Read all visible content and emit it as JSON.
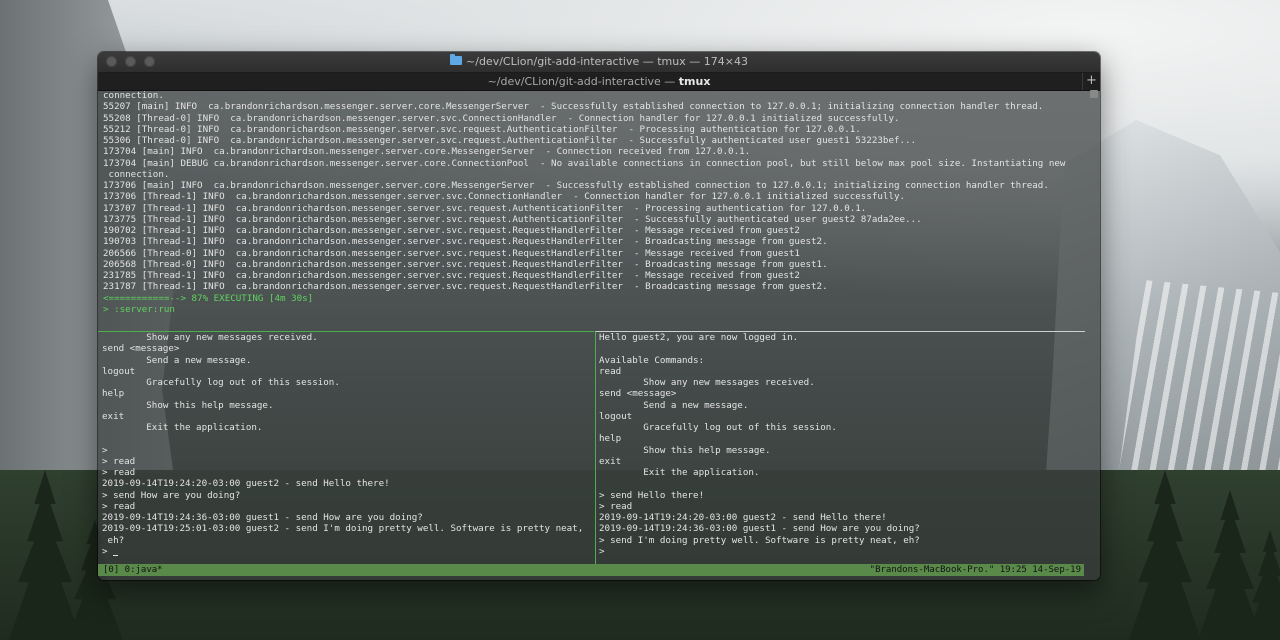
{
  "window": {
    "title": "~/dev/CLion/git-add-interactive — tmux — 174×43",
    "tab_path": "~/dev/CLion/git-add-interactive — ",
    "tab_app": "tmux",
    "add_tab": "+"
  },
  "log_lines": [
    "connection.",
    "55207 [main] INFO  ca.brandonrichardson.messenger.server.core.MessengerServer  - Successfully established connection to 127.0.0.1; initializing connection handler thread.",
    "55208 [Thread-0] INFO  ca.brandonrichardson.messenger.server.svc.ConnectionHandler  - Connection handler for 127.0.0.1 initialized successfully.",
    "55212 [Thread-0] INFO  ca.brandonrichardson.messenger.server.svc.request.AuthenticationFilter  - Processing authentication for 127.0.0.1.",
    "55306 [Thread-0] INFO  ca.brandonrichardson.messenger.server.svc.request.AuthenticationFilter  - Successfully authenticated user guest1 53223bef...",
    "173704 [main] INFO  ca.brandonrichardson.messenger.server.core.MessengerServer  - Connection received from 127.0.0.1.",
    "173704 [main] DEBUG ca.brandonrichardson.messenger.server.core.ConnectionPool  - No available connections in connection pool, but still below max pool size. Instantiating new",
    " connection.",
    "173706 [main] INFO  ca.brandonrichardson.messenger.server.core.MessengerServer  - Successfully established connection to 127.0.0.1; initializing connection handler thread.",
    "173706 [Thread-1] INFO  ca.brandonrichardson.messenger.server.svc.ConnectionHandler  - Connection handler for 127.0.0.1 initialized successfully.",
    "173707 [Thread-1] INFO  ca.brandonrichardson.messenger.server.svc.request.AuthenticationFilter  - Processing authentication for 127.0.0.1.",
    "173775 [Thread-1] INFO  ca.brandonrichardson.messenger.server.svc.request.AuthenticationFilter  - Successfully authenticated user guest2 87ada2ee...",
    "190702 [Thread-1] INFO  ca.brandonrichardson.messenger.server.svc.request.RequestHandlerFilter  - Message received from guest2",
    "190703 [Thread-1] INFO  ca.brandonrichardson.messenger.server.svc.request.RequestHandlerFilter  - Broadcasting message from guest2.",
    "206566 [Thread-0] INFO  ca.brandonrichardson.messenger.server.svc.request.RequestHandlerFilter  - Message received from guest1",
    "206568 [Thread-0] INFO  ca.brandonrichardson.messenger.server.svc.request.RequestHandlerFilter  - Broadcasting message from guest1.",
    "231785 [Thread-1] INFO  ca.brandonrichardson.messenger.server.svc.request.RequestHandlerFilter  - Message received from guest2",
    "231787 [Thread-1] INFO  ca.brandonrichardson.messenger.server.svc.request.RequestHandlerFilter  - Broadcasting message from guest2."
  ],
  "progress_line": "<===========--> 87% EXECUTING [4m 30s]",
  "gradle_task": "> :server:run",
  "left_pane": [
    "        Show any new messages received.",
    "send <message>",
    "        Send a new message.",
    "logout",
    "        Gracefully log out of this session.",
    "help",
    "        Show this help message.",
    "exit",
    "        Exit the application.",
    "",
    ">",
    "> read",
    "> read",
    "2019-09-14T19:24:20-03:00 guest2 - send Hello there!",
    "> send How are you doing?",
    "> read",
    "2019-09-14T19:24:36-03:00 guest1 - send How are you doing?",
    "2019-09-14T19:25:01-03:00 guest2 - send I'm doing pretty well. Software is pretty neat,",
    " eh?",
    "> "
  ],
  "right_pane": [
    "Hello guest2, you are now logged in.",
    "",
    "Available Commands:",
    "read",
    "        Show any new messages received.",
    "send <message>",
    "        Send a new message.",
    "logout",
    "        Gracefully log out of this session.",
    "help",
    "        Show this help message.",
    "exit",
    "        Exit the application.",
    "",
    "> send Hello there!",
    "> read",
    "2019-09-14T19:24:20-03:00 guest2 - send Hello there!",
    "2019-09-14T19:24:36-03:00 guest1 - send How are you doing?",
    "> send I'm doing pretty well. Software is pretty neat, eh?",
    ">"
  ],
  "status": {
    "left": "[0] 0:java*",
    "right": "\"Brandons-MacBook-Pro.\" 19:25 14-Sep-19"
  },
  "colors": {
    "status_bg": "#5a8a4a",
    "progress_text": "#5fd35f",
    "pane_border_active": "#4caf4c"
  }
}
